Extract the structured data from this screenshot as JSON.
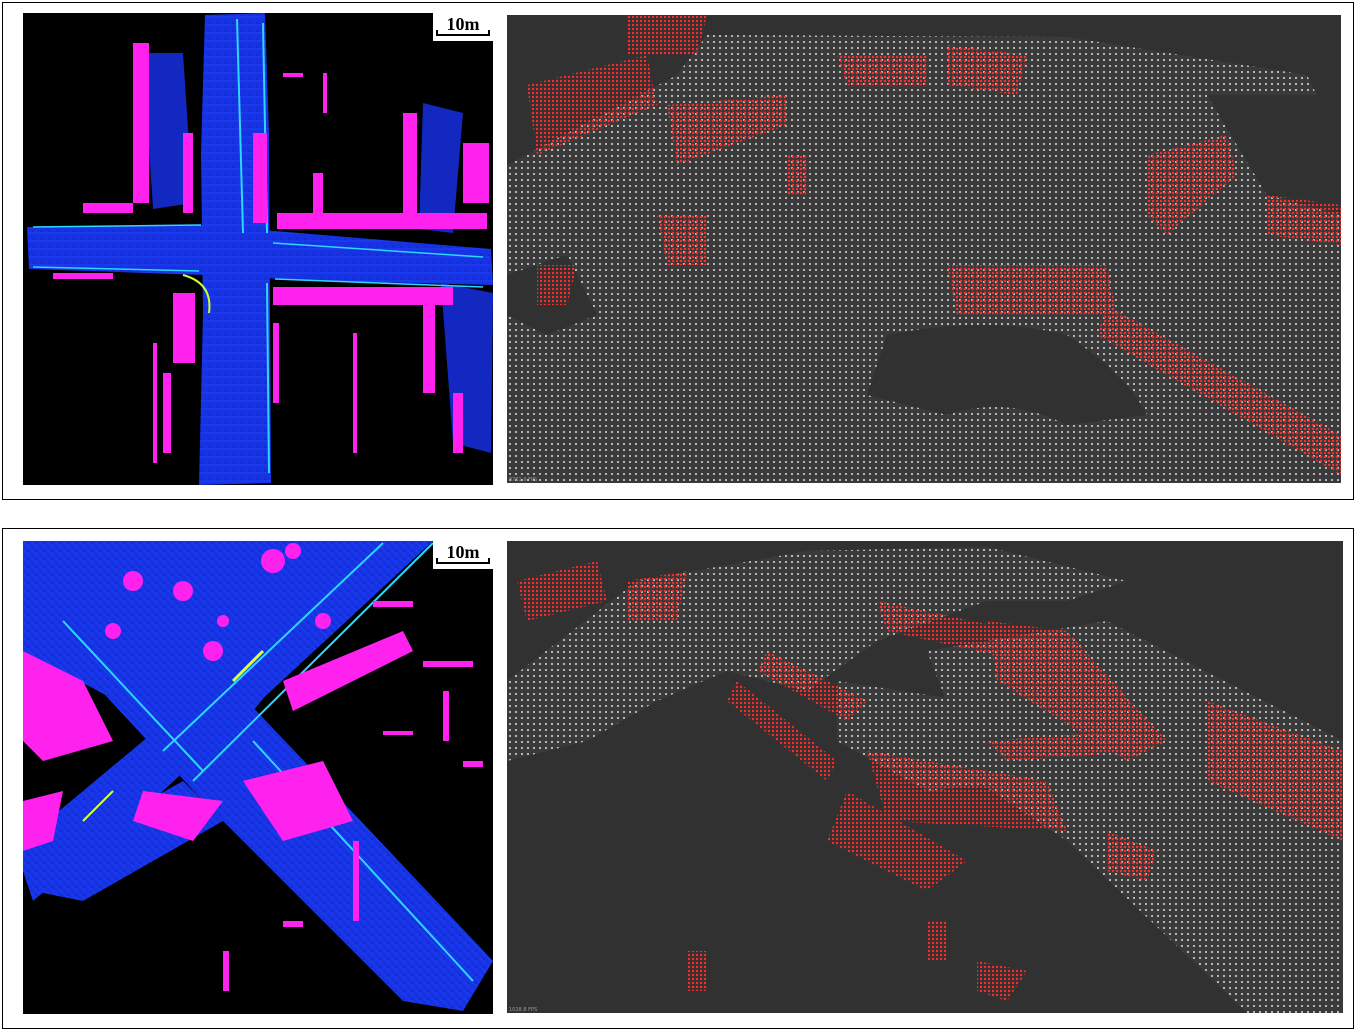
{
  "panels": [
    {
      "scale_label": "10m",
      "fps_text": "8761.9 FPS"
    },
    {
      "scale_label": "10m",
      "fps_text": "1028.8 FPS"
    }
  ],
  "colors": {
    "road_blue": "#1530e0",
    "road_edge_cyan": "#28d6ff",
    "obstacle_magenta": "#ff22ee",
    "ground_points": "#d9d9d9",
    "obstacle_points": "#ff2a2a",
    "cloud_background": "#313131"
  }
}
